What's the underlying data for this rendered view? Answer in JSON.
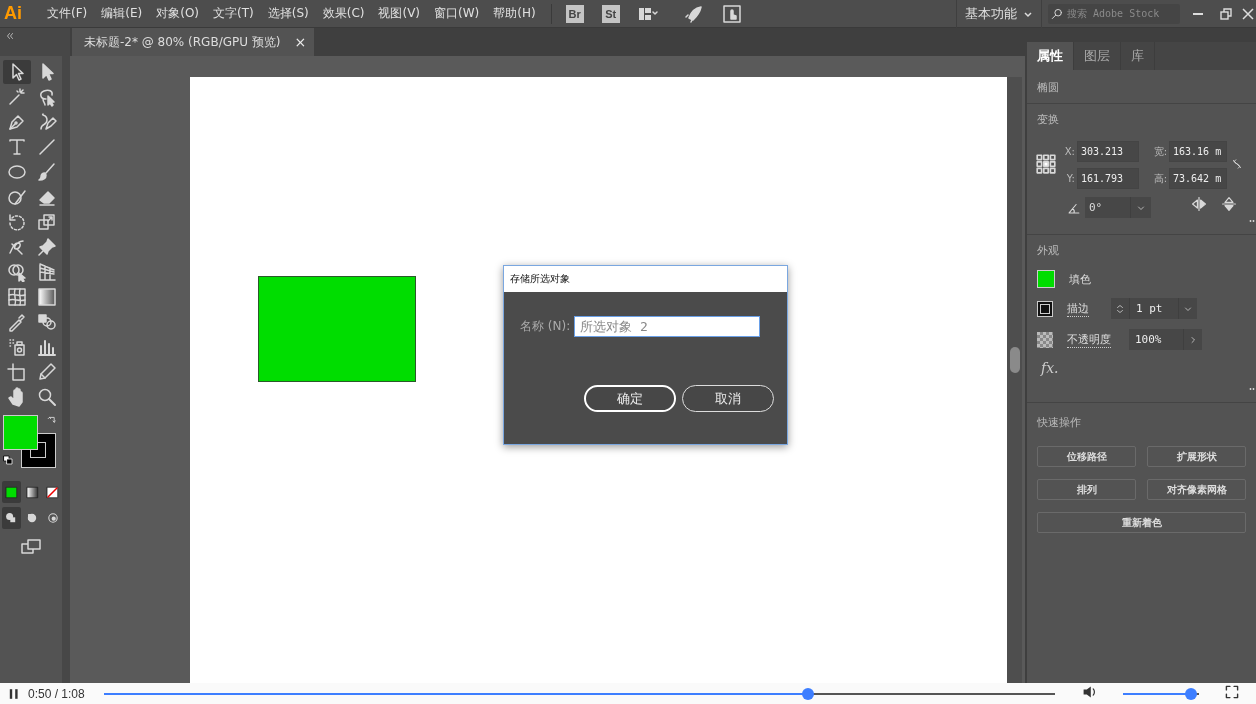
{
  "menu_bar": {
    "logo": "Ai",
    "menus": [
      "文件(F)",
      "编辑(E)",
      "对象(O)",
      "文字(T)",
      "选择(S)",
      "效果(C)",
      "视图(V)",
      "窗口(W)",
      "帮助(H)"
    ],
    "bridge": "Br",
    "stock": "St",
    "workspace": "基本功能",
    "search": {
      "placeholder": "搜索 Adobe Stock"
    }
  },
  "document_tab": {
    "title": "未标题-2* @ 80% (RGB/GPU 预览)",
    "close": "×"
  },
  "toolbar": {
    "tools": [
      {
        "selected": true
      },
      {
        "selected": false
      },
      {
        "selected": false
      },
      {
        "selected": false
      },
      {
        "selected": false
      },
      {
        "selected": false
      },
      {
        "selected": false
      },
      {
        "selected": false
      },
      {
        "selected": false
      },
      {
        "selected": false
      },
      {
        "selected": false
      },
      {
        "selected": false
      },
      {
        "selected": false
      },
      {
        "selected": false
      },
      {
        "selected": false
      },
      {
        "selected": false
      },
      {
        "selected": false
      },
      {
        "selected": false
      },
      {
        "selected": false
      },
      {
        "selected": false
      },
      {
        "selected": false
      },
      {
        "selected": false
      },
      {
        "selected": false
      },
      {
        "selected": false
      },
      {
        "selected": false
      },
      {
        "selected": false
      },
      {
        "selected": false
      },
      {
        "selected": false
      }
    ],
    "color_modes": [
      {
        "kind": "color",
        "selected": true
      },
      {
        "kind": "gradient",
        "selected": false
      },
      {
        "kind": "none",
        "selected": false
      }
    ],
    "draw_modes": [
      {
        "kind": "normal",
        "selected": true
      },
      {
        "kind": "behind",
        "selected": false
      },
      {
        "kind": "inside",
        "selected": false
      }
    ]
  },
  "dialog": {
    "title": "存储所选对象",
    "name_label": "名称 (N):",
    "name_value": "所选对象 2",
    "buttons": [
      {
        "label": "确定",
        "default": true
      },
      {
        "label": "取消",
        "default": false
      }
    ]
  },
  "properties_panel": {
    "tabs": [
      {
        "label": "属性",
        "selected": true
      },
      {
        "label": "图层",
        "selected": false
      },
      {
        "label": "库",
        "selected": false
      }
    ],
    "object_type": "椭圆",
    "transform": {
      "title": "变换",
      "fields": [
        {
          "label": "X:",
          "value": "303.213"
        },
        {
          "label": "宽:",
          "value": "163.16 m"
        },
        {
          "label": "Y:",
          "value": "161.793"
        },
        {
          "label": "高:",
          "value": "73.642 m"
        }
      ],
      "angle": "0°"
    },
    "appearance": {
      "title": "外观",
      "fill_label": "填色",
      "stroke_label": "描边",
      "stroke_weight": "1 pt",
      "opacity_label": "不透明度",
      "opacity": "100%",
      "fx": "fx."
    },
    "quick_actions": {
      "title": "快速操作",
      "buttons": [
        "位移路径",
        "扩展形状",
        "排列",
        "对齐像素网格",
        "重新着色"
      ]
    }
  },
  "video_player": {
    "playing": true,
    "time": "0:50 / 1:08",
    "progress": {
      "level": 0.74
    },
    "volume": {
      "level": 0.9
    }
  }
}
